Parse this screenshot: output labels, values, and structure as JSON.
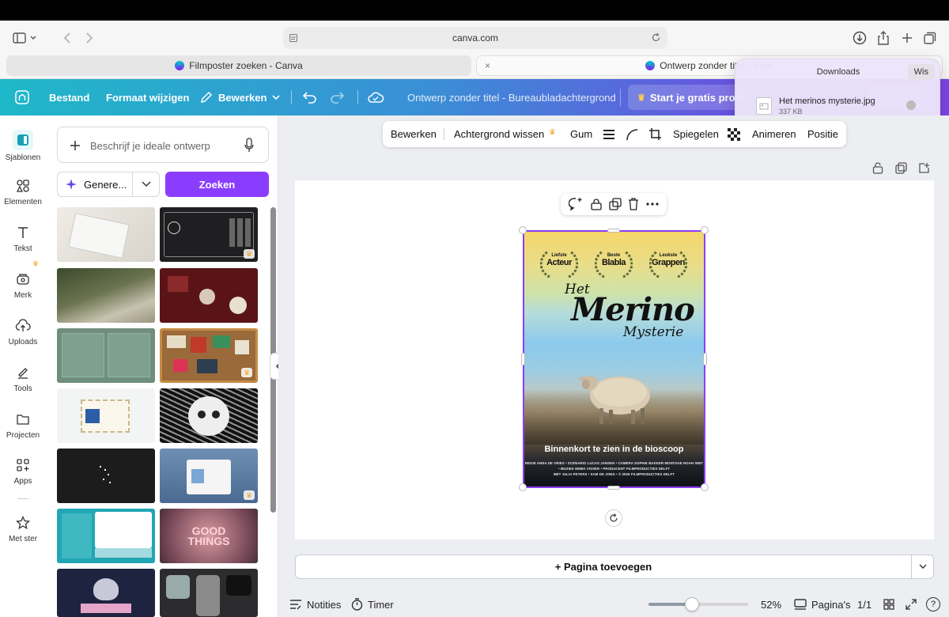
{
  "browser": {
    "url": "canva.com",
    "tabs": [
      {
        "label": "Filmposter zoeken - Canva"
      },
      {
        "label": "Ontwerp zonder titel - Bure"
      }
    ]
  },
  "downloads": {
    "title": "Downloads",
    "clear_label": "Wis",
    "file_name": "Het merinos mysterie.jpg",
    "file_size": "337 KB"
  },
  "header": {
    "file_label": "Bestand",
    "resize_label": "Formaat wijzigen",
    "edit_label": "Bewerken",
    "doc_title": "Ontwerp zonder titel - Bureaubladachtergrond",
    "trial_label": "Start je gratis proef"
  },
  "rail": {
    "items": [
      {
        "label": "Sjablonen"
      },
      {
        "label": "Elementen"
      },
      {
        "label": "Tekst"
      },
      {
        "label": "Merk"
      },
      {
        "label": "Uploads"
      },
      {
        "label": "Tools"
      },
      {
        "label": "Projecten"
      },
      {
        "label": "Apps"
      },
      {
        "label": "Met ster"
      }
    ]
  },
  "panel": {
    "search_placeholder": "Beschrijf je ideale ontwerp",
    "generate_label": "Genere...",
    "search_button": "Zoeken"
  },
  "context_toolbar": {
    "edit": "Bewerken",
    "remove_bg": "Achtergrond wissen",
    "eraser": "Gum",
    "flip": "Spiegelen",
    "animate": "Animeren",
    "position": "Positie"
  },
  "poster": {
    "laurels": [
      {
        "small": "Liefste",
        "big": "Acteur"
      },
      {
        "small": "Beste",
        "big": "Blabla"
      },
      {
        "small": "Leukste",
        "big": "Grappen"
      }
    ],
    "title_het": "Het",
    "title_merino": "Merino",
    "title_mysterie": "Mysterie",
    "coming_soon": "Binnenkort te zien in de bioscoop",
    "credits": [
      "REGIE ANNA DE VRIES • SCENARIO LUCAS JANSEN • CAMERA SOPHIE BAKKER MONTAGE NOAH SMIT",
      "• MUZIEK EMMA VISSER • PRODUCENT FILMPRODUCTIES DELFT",
      "MET JULIA PETERS • SAM DE JONG • © 2026 FILMPRODUCTIES DELFT"
    ]
  },
  "workspace": {
    "add_page_label": "+ Pagina toevoegen"
  },
  "footer": {
    "notes_label": "Notities",
    "timer_label": "Timer",
    "zoom_value": "52%",
    "pages_label": "Pagina's",
    "page_count": "1/1",
    "help_label": "?"
  },
  "colors": {
    "accent": "#8b3dff",
    "header_gradient_start": "#1fb8c8",
    "header_gradient_end": "#7c45e8"
  }
}
